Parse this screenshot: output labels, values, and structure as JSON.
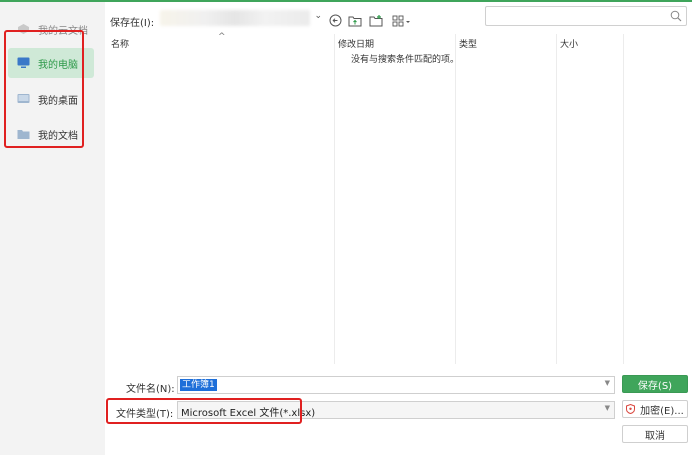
{
  "sidebar": {
    "items": [
      {
        "label": "我的云文档",
        "icon": "cloud-doc-icon"
      },
      {
        "label": "我的电脑",
        "icon": "computer-icon"
      },
      {
        "label": "我的桌面",
        "icon": "desktop-icon"
      },
      {
        "label": "我的文档",
        "icon": "folder-icon"
      }
    ]
  },
  "toolbar": {
    "save_in_label": "保存在(I):",
    "path_value": "",
    "icons": [
      "back-icon",
      "parent-folder-icon",
      "new-folder-icon",
      "view-mode-icon"
    ],
    "search_placeholder": ""
  },
  "file_list": {
    "columns": [
      "名称",
      "修改日期",
      "类型",
      "大小"
    ],
    "empty_message": "没有与搜索条件匹配的项。",
    "sort_indicator": "^"
  },
  "form": {
    "file_name_label": "文件名(N):",
    "file_name_value": "工作簿1",
    "file_type_label": "文件类型(T):",
    "file_type_value": "Microsoft Excel 文件(*.xlsx)"
  },
  "buttons": {
    "save": "保存(S)",
    "encrypt": "加密(E)...",
    "cancel": "取消"
  },
  "colors": {
    "accent": "#3fa55b",
    "active_item_bg": "#cfe9d7",
    "highlight_box": "#e02020",
    "selection": "#1e6fd9"
  }
}
